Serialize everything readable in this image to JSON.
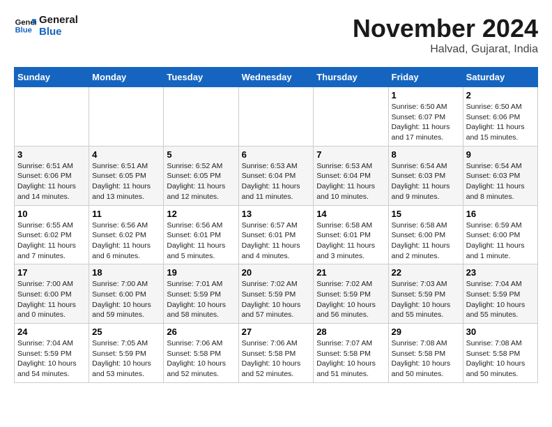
{
  "header": {
    "logo_line1": "General",
    "logo_line2": "Blue",
    "month_title": "November 2024",
    "location": "Halvad, Gujarat, India"
  },
  "weekdays": [
    "Sunday",
    "Monday",
    "Tuesday",
    "Wednesday",
    "Thursday",
    "Friday",
    "Saturday"
  ],
  "weeks": [
    [
      {
        "day": "",
        "info": ""
      },
      {
        "day": "",
        "info": ""
      },
      {
        "day": "",
        "info": ""
      },
      {
        "day": "",
        "info": ""
      },
      {
        "day": "",
        "info": ""
      },
      {
        "day": "1",
        "info": "Sunrise: 6:50 AM\nSunset: 6:07 PM\nDaylight: 11 hours and 17 minutes."
      },
      {
        "day": "2",
        "info": "Sunrise: 6:50 AM\nSunset: 6:06 PM\nDaylight: 11 hours and 15 minutes."
      }
    ],
    [
      {
        "day": "3",
        "info": "Sunrise: 6:51 AM\nSunset: 6:06 PM\nDaylight: 11 hours and 14 minutes."
      },
      {
        "day": "4",
        "info": "Sunrise: 6:51 AM\nSunset: 6:05 PM\nDaylight: 11 hours and 13 minutes."
      },
      {
        "day": "5",
        "info": "Sunrise: 6:52 AM\nSunset: 6:05 PM\nDaylight: 11 hours and 12 minutes."
      },
      {
        "day": "6",
        "info": "Sunrise: 6:53 AM\nSunset: 6:04 PM\nDaylight: 11 hours and 11 minutes."
      },
      {
        "day": "7",
        "info": "Sunrise: 6:53 AM\nSunset: 6:04 PM\nDaylight: 11 hours and 10 minutes."
      },
      {
        "day": "8",
        "info": "Sunrise: 6:54 AM\nSunset: 6:03 PM\nDaylight: 11 hours and 9 minutes."
      },
      {
        "day": "9",
        "info": "Sunrise: 6:54 AM\nSunset: 6:03 PM\nDaylight: 11 hours and 8 minutes."
      }
    ],
    [
      {
        "day": "10",
        "info": "Sunrise: 6:55 AM\nSunset: 6:02 PM\nDaylight: 11 hours and 7 minutes."
      },
      {
        "day": "11",
        "info": "Sunrise: 6:56 AM\nSunset: 6:02 PM\nDaylight: 11 hours and 6 minutes."
      },
      {
        "day": "12",
        "info": "Sunrise: 6:56 AM\nSunset: 6:01 PM\nDaylight: 11 hours and 5 minutes."
      },
      {
        "day": "13",
        "info": "Sunrise: 6:57 AM\nSunset: 6:01 PM\nDaylight: 11 hours and 4 minutes."
      },
      {
        "day": "14",
        "info": "Sunrise: 6:58 AM\nSunset: 6:01 PM\nDaylight: 11 hours and 3 minutes."
      },
      {
        "day": "15",
        "info": "Sunrise: 6:58 AM\nSunset: 6:00 PM\nDaylight: 11 hours and 2 minutes."
      },
      {
        "day": "16",
        "info": "Sunrise: 6:59 AM\nSunset: 6:00 PM\nDaylight: 11 hours and 1 minute."
      }
    ],
    [
      {
        "day": "17",
        "info": "Sunrise: 7:00 AM\nSunset: 6:00 PM\nDaylight: 11 hours and 0 minutes."
      },
      {
        "day": "18",
        "info": "Sunrise: 7:00 AM\nSunset: 6:00 PM\nDaylight: 10 hours and 59 minutes."
      },
      {
        "day": "19",
        "info": "Sunrise: 7:01 AM\nSunset: 5:59 PM\nDaylight: 10 hours and 58 minutes."
      },
      {
        "day": "20",
        "info": "Sunrise: 7:02 AM\nSunset: 5:59 PM\nDaylight: 10 hours and 57 minutes."
      },
      {
        "day": "21",
        "info": "Sunrise: 7:02 AM\nSunset: 5:59 PM\nDaylight: 10 hours and 56 minutes."
      },
      {
        "day": "22",
        "info": "Sunrise: 7:03 AM\nSunset: 5:59 PM\nDaylight: 10 hours and 55 minutes."
      },
      {
        "day": "23",
        "info": "Sunrise: 7:04 AM\nSunset: 5:59 PM\nDaylight: 10 hours and 55 minutes."
      }
    ],
    [
      {
        "day": "24",
        "info": "Sunrise: 7:04 AM\nSunset: 5:59 PM\nDaylight: 10 hours and 54 minutes."
      },
      {
        "day": "25",
        "info": "Sunrise: 7:05 AM\nSunset: 5:59 PM\nDaylight: 10 hours and 53 minutes."
      },
      {
        "day": "26",
        "info": "Sunrise: 7:06 AM\nSunset: 5:58 PM\nDaylight: 10 hours and 52 minutes."
      },
      {
        "day": "27",
        "info": "Sunrise: 7:06 AM\nSunset: 5:58 PM\nDaylight: 10 hours and 52 minutes."
      },
      {
        "day": "28",
        "info": "Sunrise: 7:07 AM\nSunset: 5:58 PM\nDaylight: 10 hours and 51 minutes."
      },
      {
        "day": "29",
        "info": "Sunrise: 7:08 AM\nSunset: 5:58 PM\nDaylight: 10 hours and 50 minutes."
      },
      {
        "day": "30",
        "info": "Sunrise: 7:08 AM\nSunset: 5:58 PM\nDaylight: 10 hours and 50 minutes."
      }
    ]
  ]
}
